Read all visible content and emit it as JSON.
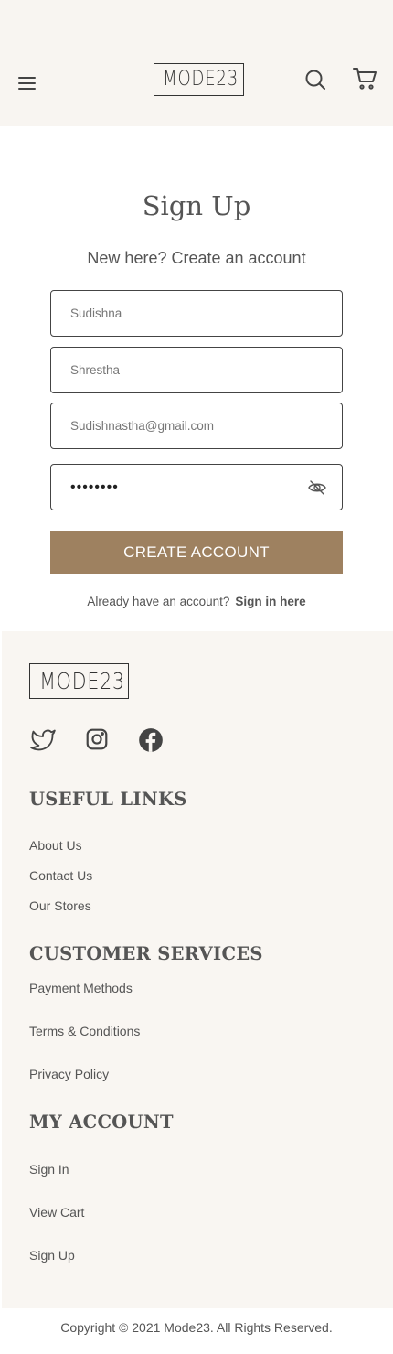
{
  "header": {
    "logo_text": "MODE23",
    "menu_icon": "hamburger-icon",
    "search_icon": "search-icon",
    "cart_icon": "cart-icon"
  },
  "signup": {
    "title": "Sign Up",
    "subtitle": "New here? Create an account",
    "first_name_value": "Sudishna",
    "last_name_value": "Shrestha",
    "email_value": "Sudishnastha@gmail.com",
    "password_value": "••••••••",
    "password_toggle_icon": "eye-off-icon",
    "create_button_label": "CREATE ACCOUNT",
    "have_account_text": "Already have an account?",
    "signin_link": "Sign in here"
  },
  "footer": {
    "logo_text": "MODE23",
    "social_icons": [
      "twitter-icon",
      "instagram-icon",
      "facebook-icon"
    ],
    "useful_links": {
      "heading": "USEFUL LINKS",
      "items": [
        "About Us",
        "Contact Us",
        "Our Stores"
      ]
    },
    "customer_services": {
      "heading": "CUSTOMER SERVICES",
      "items": [
        "Payment Methods",
        "Terms & Conditions",
        "Privacy Policy"
      ]
    },
    "my_account": {
      "heading": "MY ACCOUNT",
      "items": [
        "Sign In",
        "View Cart",
        "Sign Up"
      ]
    },
    "copyright": "Copyright © 2021 Mode23. All Rights Reserved."
  },
  "colors": {
    "header_bg": "#f8f5f1",
    "footer_bg": "#f9f6f2",
    "accent_button": "#9e8160",
    "text": "#555555"
  }
}
